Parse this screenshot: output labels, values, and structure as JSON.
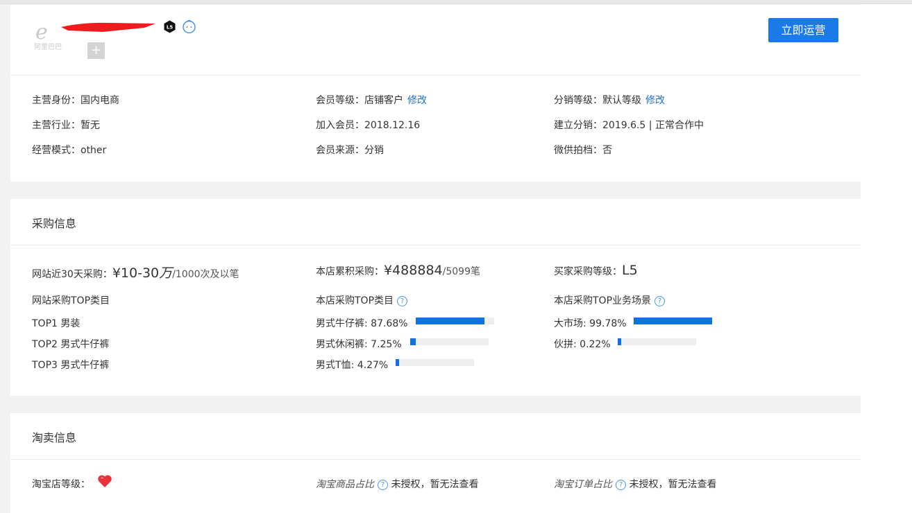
{
  "header": {
    "logo_text": "阿里巴巴",
    "level_badge": "L5",
    "plus_label": "+",
    "operate_button": "立即运营"
  },
  "profile": {
    "identity_label": "主营身份：",
    "identity_value": "国内电商",
    "industry_label": "主营行业：",
    "industry_value": "暂无",
    "mode_label": "经营模式：",
    "mode_value": "other",
    "member_level_label": "会员等级：",
    "member_level_value": "店铺客户",
    "member_level_edit": "修改",
    "join_label": "加入会员：",
    "join_value": "2018.12.16",
    "source_label": "会员来源：",
    "source_value": "分销",
    "dist_level_label": "分销等级：",
    "dist_level_value": "默认等级",
    "dist_level_edit": "修改",
    "dist_setup_label": "建立分销：",
    "dist_setup_value": "2019.6.5 | 正常合作中",
    "weigong_label": "微供拍档：",
    "weigong_value": "否"
  },
  "purchase": {
    "title": "采购信息",
    "site30_label": "网站近30天采购：",
    "site30_amount": "¥10-30",
    "site30_unit": "万",
    "site30_count": "/1000次及以笔",
    "store_total_label": "本店累积采购：",
    "store_total_amount": "¥488884",
    "store_total_count": "/5099笔",
    "buyer_level_label": "买家采购等级：",
    "buyer_level_value": "L5",
    "site_top_title": "网站采购TOP类目",
    "site_top": [
      {
        "rank": "TOP1",
        "name": "男装"
      },
      {
        "rank": "TOP2",
        "name": "男式牛仔裤"
      },
      {
        "rank": "TOP3",
        "name": "男式牛仔裤"
      }
    ],
    "store_top_title": "本店采购TOP类目",
    "store_top": [
      {
        "name": "男式牛仔裤",
        "pct_text": "87.68%",
        "pct": 0.8768
      },
      {
        "name": "男式休闲裤",
        "pct_text": "7.25%",
        "pct": 0.0725
      },
      {
        "name": "男式T恤",
        "pct_text": "4.27%",
        "pct": 0.0427
      }
    ],
    "scene_top_title": "本店采购TOP业务场景",
    "scene_top": [
      {
        "name": "大市场",
        "pct_text": "99.78%",
        "pct": 0.9978
      },
      {
        "name": "伙拼",
        "pct_text": "0.22%",
        "pct": 0.0022
      }
    ],
    "help_icon": "?"
  },
  "taobao": {
    "title": "淘卖信息",
    "shop_level_label": "淘宝店等级：",
    "goods_ratio_label": "淘宝商品占比",
    "goods_ratio_value": "未授权，暂无法查看",
    "order_ratio_label": "淘宝订单占比",
    "order_ratio_value": "未授权，暂无法查看",
    "help_icon": "?"
  },
  "colors": {
    "accent": "#1a7be8",
    "bar_fill": "#1071e5",
    "bar_track": "#eeeeee",
    "link": "#1f6fcf",
    "page_bg": "#f2f2f2"
  }
}
